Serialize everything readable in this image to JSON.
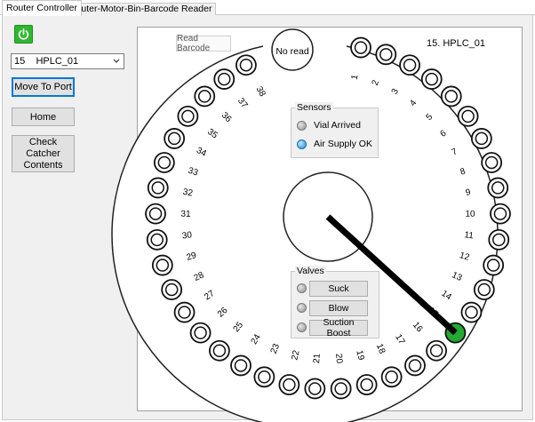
{
  "tabs": [
    {
      "label": "Router Controller",
      "active": true
    },
    {
      "label": "Router-Motor-Bin-Barcode Reader",
      "active": false
    }
  ],
  "left_panel": {
    "power_icon": "power-icon",
    "power_color": "#2eb82e",
    "port_select_value": "15    HPLC_01",
    "move_button": "Move To Port",
    "home_button": "Home",
    "check_catcher_button": "Check Catcher Contents"
  },
  "canvas": {
    "read_barcode_label": "Read Barcode",
    "no_read_label": "No read",
    "port_label": "15. HPLC_01",
    "selected_port": 15,
    "selected_color": "#22aa33",
    "port_numbers": [
      "1",
      "2",
      "3",
      "4",
      "5",
      "6",
      "7",
      "8",
      "9",
      "10",
      "11",
      "12",
      "13",
      "14",
      "15",
      "16",
      "17",
      "18",
      "19",
      "20",
      "21",
      "22",
      "23",
      "24",
      "25",
      "26",
      "27",
      "28",
      "29",
      "30",
      "31",
      "32",
      "33",
      "34",
      "35",
      "36",
      "37",
      "38"
    ]
  },
  "sensors": {
    "title": "Sensors",
    "items": [
      {
        "label": "Vial Arrived",
        "state": "off"
      },
      {
        "label": "Air Supply OK",
        "state": "on"
      }
    ]
  },
  "valves": {
    "title": "Valves",
    "items": [
      {
        "label": "Suck"
      },
      {
        "label": "Blow"
      },
      {
        "label": "Suction Boost"
      }
    ]
  }
}
